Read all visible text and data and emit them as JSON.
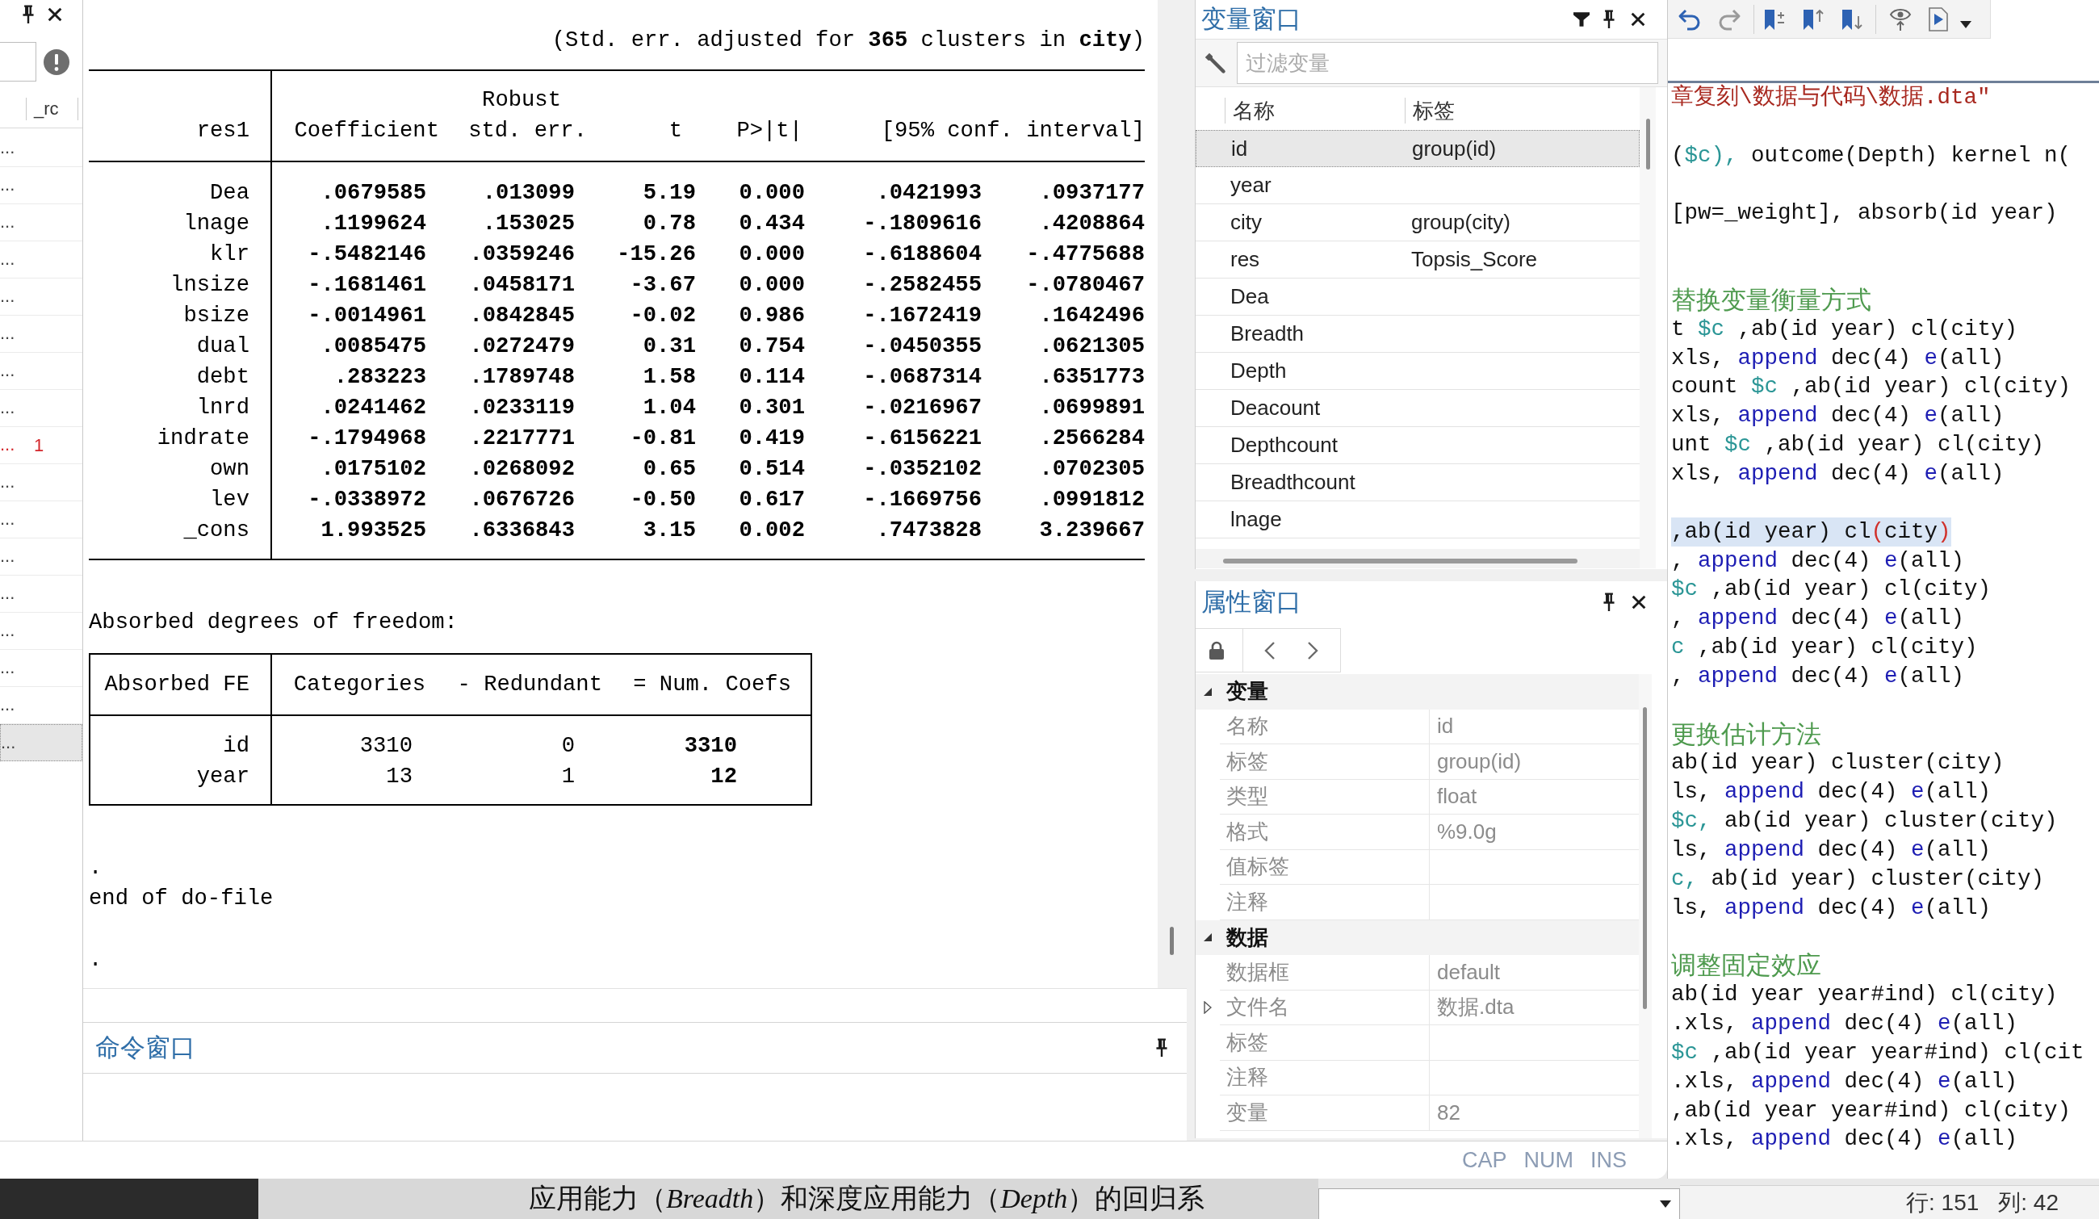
{
  "history": {
    "column": "_rc",
    "items": [
      {
        "text": "...",
        "error": false,
        "selected": false
      },
      {
        "text": "...",
        "error": false,
        "selected": false
      },
      {
        "text": "...",
        "error": false,
        "selected": false
      },
      {
        "text": "...",
        "error": false,
        "selected": false
      },
      {
        "text": "...",
        "error": false,
        "selected": false
      },
      {
        "text": "...",
        "error": false,
        "selected": false
      },
      {
        "text": "...",
        "error": false,
        "selected": false
      },
      {
        "text": "...",
        "error": false,
        "selected": false
      },
      {
        "text": "...",
        "rc": "1",
        "error": true,
        "selected": false
      },
      {
        "text": "...",
        "error": false,
        "selected": false
      },
      {
        "text": "...",
        "error": false,
        "selected": false
      },
      {
        "text": "...",
        "error": false,
        "selected": false
      },
      {
        "text": "...",
        "error": false,
        "selected": false
      },
      {
        "text": "...",
        "error": false,
        "selected": false
      },
      {
        "text": "...",
        "error": false,
        "selected": false
      },
      {
        "text": "...",
        "error": false,
        "selected": false
      },
      {
        "text": "...",
        "error": false,
        "selected": true
      }
    ]
  },
  "results": {
    "cluster_note": "(Std. err. adjusted for **365** clusters in **city**)",
    "regression": {
      "header_top": "Robust",
      "columns": [
        "res1",
        "Coefficient",
        "std. err.",
        "t",
        "P>|t|",
        "[95% conf. interval]"
      ],
      "rows": [
        [
          "Dea",
          ".0679585",
          ".013099",
          "5.19",
          "0.000",
          ".0421993",
          ".0937177"
        ],
        [
          "lnage",
          ".1199624",
          ".153025",
          "0.78",
          "0.434",
          "-.1809616",
          ".4208864"
        ],
        [
          "klr",
          "-.5482146",
          ".0359246",
          "-15.26",
          "0.000",
          "-.6188604",
          "-.4775688"
        ],
        [
          "lnsize",
          "-.1681461",
          ".0458171",
          "-3.67",
          "0.000",
          "-.2582455",
          "-.0780467"
        ],
        [
          "bsize",
          "-.0014961",
          ".0842845",
          "-0.02",
          "0.986",
          "-.1672419",
          ".1642496"
        ],
        [
          "dual",
          ".0085475",
          ".0272479",
          "0.31",
          "0.754",
          "-.0450355",
          ".0621305"
        ],
        [
          "debt",
          ".283223",
          ".1789748",
          "1.58",
          "0.114",
          "-.0687314",
          ".6351773"
        ],
        [
          "lnrd",
          ".0241462",
          ".0233119",
          "1.04",
          "0.301",
          "-.0216967",
          ".0699891"
        ],
        [
          "indrate",
          "-.1794968",
          ".2217771",
          "-0.81",
          "0.419",
          "-.6156221",
          ".2566284"
        ],
        [
          "own",
          ".0175102",
          ".0268092",
          "0.65",
          "0.514",
          "-.0352102",
          ".0702305"
        ],
        [
          "lev",
          "-.0338972",
          ".0676726",
          "-0.50",
          "0.617",
          "-.1669756",
          ".0991812"
        ],
        [
          "_cons",
          "1.993525",
          ".6336843",
          "3.15",
          "0.002",
          ".7473828",
          "3.239667"
        ]
      ]
    },
    "absorbed_title": "Absorbed degrees of freedom:",
    "absorbed": {
      "columns": [
        "Absorbed FE",
        "Categories",
        "- Redundant",
        "= Num. Coefs"
      ],
      "rows": [
        [
          "id",
          "3310",
          "0",
          "3310"
        ],
        [
          "year",
          "13",
          "1",
          "12"
        ]
      ]
    },
    "log_lines": [
      ".",
      "end of do-file",
      "."
    ]
  },
  "command_window": {
    "title": "命令窗口"
  },
  "status_bar": {
    "indicators": [
      "CAP",
      "NUM",
      "INS"
    ]
  },
  "variables_window": {
    "title": "变量窗口",
    "filter": {
      "placeholder": "过滤变量"
    },
    "columns": [
      "名称",
      "标签"
    ],
    "rows": [
      {
        "name": "id",
        "label": "group(id)",
        "selected": true
      },
      {
        "name": "year",
        "selected": false
      },
      {
        "name": "city",
        "label": "group(city)",
        "selected": false
      },
      {
        "name": "res",
        "label": "Topsis_Score",
        "selected": false
      },
      {
        "name": "Dea",
        "selected": false
      },
      {
        "name": "Breadth",
        "selected": false
      },
      {
        "name": "Depth",
        "selected": false
      },
      {
        "name": "Deacount",
        "selected": false
      },
      {
        "name": "Depthcount",
        "selected": false
      },
      {
        "name": "Breadthcount",
        "selected": false
      },
      {
        "name": "lnage",
        "selected": false
      }
    ]
  },
  "properties_window": {
    "title": "属性窗口",
    "groups": [
      {
        "title": "变量",
        "expanded": true,
        "rows": [
          {
            "key": "名称",
            "value": "id"
          },
          {
            "key": "标签",
            "value": "group(id)"
          },
          {
            "key": "类型",
            "value": "float"
          },
          {
            "key": "格式",
            "value": "%9.0g"
          },
          {
            "key": "值标签"
          },
          {
            "key": "注释"
          }
        ]
      },
      {
        "title": "数据",
        "expanded": true,
        "rows": [
          {
            "key": "数据框",
            "value": "default"
          },
          {
            "key": "文件名",
            "value": "数据.dta",
            "expanded": false
          },
          {
            "key": "标签"
          },
          {
            "key": "注释"
          },
          {
            "key": "变量",
            "value": "82"
          }
        ]
      }
    ]
  },
  "do_file_editor": {
    "lines": [
      {
        "kind": "code",
        "current": false,
        "tokens": [
          {
            "kind": "string",
            "text": "章复刻\\数据与代码\\数据.dta\""
          }
        ]
      },
      {
        "kind": "blank",
        "current": false
      },
      {
        "kind": "code",
        "current": false,
        "tokens": [
          {
            "kind": "text",
            "text": "("
          },
          {
            "kind": "macro",
            "text": "$c),"
          },
          {
            "kind": "text",
            "text": " outcome(Depth) kernel n("
          }
        ]
      },
      {
        "kind": "blank",
        "current": false
      },
      {
        "kind": "code",
        "current": false,
        "tokens": [
          {
            "kind": "text",
            "text": "[pw=_weight], absorb(id year)"
          }
        ]
      },
      {
        "kind": "blank",
        "current": false
      },
      {
        "kind": "blank",
        "current": false
      },
      {
        "kind": "comment",
        "current": false,
        "text": "替换变量衡量方式"
      },
      {
        "kind": "code",
        "current": false,
        "tokens": [
          {
            "kind": "text",
            "text": "t "
          },
          {
            "kind": "macro",
            "text": "$c"
          },
          {
            "kind": "text",
            "text": " ,ab(id year) cl(city)"
          }
        ]
      },
      {
        "kind": "code",
        "current": false,
        "tokens": [
          {
            "kind": "text",
            "text": "xls, "
          },
          {
            "kind": "keyword",
            "text": "append"
          },
          {
            "kind": "text",
            "text": " dec(4) "
          },
          {
            "kind": "keyword",
            "text": "e"
          },
          {
            "kind": "text",
            "text": "(all)"
          }
        ]
      },
      {
        "kind": "code",
        "current": false,
        "tokens": [
          {
            "kind": "text",
            "text": "count "
          },
          {
            "kind": "macro",
            "text": "$c"
          },
          {
            "kind": "text",
            "text": " ,ab(id year) cl(city)"
          }
        ]
      },
      {
        "kind": "code",
        "current": false,
        "tokens": [
          {
            "kind": "text",
            "text": "xls, "
          },
          {
            "kind": "keyword",
            "text": "append"
          },
          {
            "kind": "text",
            "text": " dec(4) "
          },
          {
            "kind": "keyword",
            "text": "e"
          },
          {
            "kind": "text",
            "text": "(all)"
          }
        ]
      },
      {
        "kind": "code",
        "current": false,
        "tokens": [
          {
            "kind": "text",
            "text": "unt "
          },
          {
            "kind": "macro",
            "text": "$c"
          },
          {
            "kind": "text",
            "text": " ,ab(id year) cl(city)"
          }
        ]
      },
      {
        "kind": "code",
        "current": false,
        "tokens": [
          {
            "kind": "text",
            "text": "xls, "
          },
          {
            "kind": "keyword",
            "text": "append"
          },
          {
            "kind": "text",
            "text": " dec(4) "
          },
          {
            "kind": "keyword",
            "text": "e"
          },
          {
            "kind": "text",
            "text": "(all)"
          }
        ]
      },
      {
        "kind": "blank",
        "current": false
      },
      {
        "kind": "code",
        "current": true,
        "tokens": [
          {
            "kind": "text",
            "text": ",ab(id year) cl"
          },
          {
            "kind": "bracket",
            "text": "("
          },
          {
            "kind": "text",
            "text": "city"
          },
          {
            "kind": "bracket",
            "text": ")"
          }
        ]
      },
      {
        "kind": "code",
        "current": false,
        "tokens": [
          {
            "kind": "text",
            "text": ", "
          },
          {
            "kind": "keyword",
            "text": "append"
          },
          {
            "kind": "text",
            "text": " dec(4) "
          },
          {
            "kind": "keyword",
            "text": "e"
          },
          {
            "kind": "text",
            "text": "(all)"
          }
        ]
      },
      {
        "kind": "code",
        "current": false,
        "tokens": [
          {
            "kind": "macro",
            "text": "$c"
          },
          {
            "kind": "text",
            "text": " ,ab(id year) cl(city)"
          }
        ]
      },
      {
        "kind": "code",
        "current": false,
        "tokens": [
          {
            "kind": "text",
            "text": ", "
          },
          {
            "kind": "keyword",
            "text": "append"
          },
          {
            "kind": "text",
            "text": " dec(4) "
          },
          {
            "kind": "keyword",
            "text": "e"
          },
          {
            "kind": "text",
            "text": "(all)"
          }
        ]
      },
      {
        "kind": "code",
        "current": false,
        "tokens": [
          {
            "kind": "macro",
            "text": "c"
          },
          {
            "kind": "text",
            "text": " ,ab(id year) cl(city)"
          }
        ]
      },
      {
        "kind": "code",
        "current": false,
        "tokens": [
          {
            "kind": "text",
            "text": ", "
          },
          {
            "kind": "keyword",
            "text": "append"
          },
          {
            "kind": "text",
            "text": " dec(4) "
          },
          {
            "kind": "keyword",
            "text": "e"
          },
          {
            "kind": "text",
            "text": "(all)"
          }
        ]
      },
      {
        "kind": "blank",
        "current": false
      },
      {
        "kind": "comment",
        "current": false,
        "text": "更换估计方法"
      },
      {
        "kind": "code",
        "current": false,
        "tokens": [
          {
            "kind": "text",
            "text": "ab(id year) cluster(city)"
          }
        ]
      },
      {
        "kind": "code",
        "current": false,
        "tokens": [
          {
            "kind": "text",
            "text": "ls, "
          },
          {
            "kind": "keyword",
            "text": "append"
          },
          {
            "kind": "text",
            "text": " dec(4) "
          },
          {
            "kind": "keyword",
            "text": "e"
          },
          {
            "kind": "text",
            "text": "(all)"
          }
        ]
      },
      {
        "kind": "code",
        "current": false,
        "tokens": [
          {
            "kind": "macro",
            "text": "$c,"
          },
          {
            "kind": "text",
            "text": " ab(id year) cluster(city)"
          }
        ]
      },
      {
        "kind": "code",
        "current": false,
        "tokens": [
          {
            "kind": "text",
            "text": "ls, "
          },
          {
            "kind": "keyword",
            "text": "append"
          },
          {
            "kind": "text",
            "text": " dec(4) "
          },
          {
            "kind": "keyword",
            "text": "e"
          },
          {
            "kind": "text",
            "text": "(all)"
          }
        ]
      },
      {
        "kind": "code",
        "current": false,
        "tokens": [
          {
            "kind": "macro",
            "text": "c,"
          },
          {
            "kind": "text",
            "text": " ab(id year) cluster(city)"
          }
        ]
      },
      {
        "kind": "code",
        "current": false,
        "tokens": [
          {
            "kind": "text",
            "text": "ls, "
          },
          {
            "kind": "keyword",
            "text": "append"
          },
          {
            "kind": "text",
            "text": " dec(4) "
          },
          {
            "kind": "keyword",
            "text": "e"
          },
          {
            "kind": "text",
            "text": "(all)"
          }
        ]
      },
      {
        "kind": "blank",
        "current": false
      },
      {
        "kind": "comment",
        "current": false,
        "text": "调整固定效应"
      },
      {
        "kind": "code",
        "current": false,
        "tokens": [
          {
            "kind": "text",
            "text": "ab(id year year#ind) cl(city)"
          }
        ]
      },
      {
        "kind": "code",
        "current": false,
        "tokens": [
          {
            "kind": "text",
            "text": ".xls, "
          },
          {
            "kind": "keyword",
            "text": "append"
          },
          {
            "kind": "text",
            "text": " dec(4) "
          },
          {
            "kind": "keyword",
            "text": "e"
          },
          {
            "kind": "text",
            "text": "(all)"
          }
        ]
      },
      {
        "kind": "code",
        "current": false,
        "tokens": [
          {
            "kind": "macro",
            "text": "$c"
          },
          {
            "kind": "text",
            "text": " ,ab(id year year#ind) cl(cit"
          }
        ]
      },
      {
        "kind": "code",
        "current": false,
        "tokens": [
          {
            "kind": "text",
            "text": ".xls, "
          },
          {
            "kind": "keyword",
            "text": "append"
          },
          {
            "kind": "text",
            "text": " dec(4) "
          },
          {
            "kind": "keyword",
            "text": "e"
          },
          {
            "kind": "text",
            "text": "(all)"
          }
        ]
      },
      {
        "kind": "code",
        "current": false,
        "tokens": [
          {
            "kind": "text",
            "text": ",ab(id year year#ind) cl(city)"
          }
        ]
      },
      {
        "kind": "code",
        "current": false,
        "tokens": [
          {
            "kind": "text",
            "text": ".xls, "
          },
          {
            "kind": "keyword",
            "text": "append"
          },
          {
            "kind": "text",
            "text": " dec(4) "
          },
          {
            "kind": "keyword",
            "text": "e"
          },
          {
            "kind": "text",
            "text": "(all)"
          }
        ]
      }
    ]
  },
  "editor_status": {
    "line": "行: 151",
    "column": "列: 42"
  },
  "background_document": {
    "text": "应用能力（*Breadth*）和深度应用能力（*Depth*）的回归系"
  }
}
